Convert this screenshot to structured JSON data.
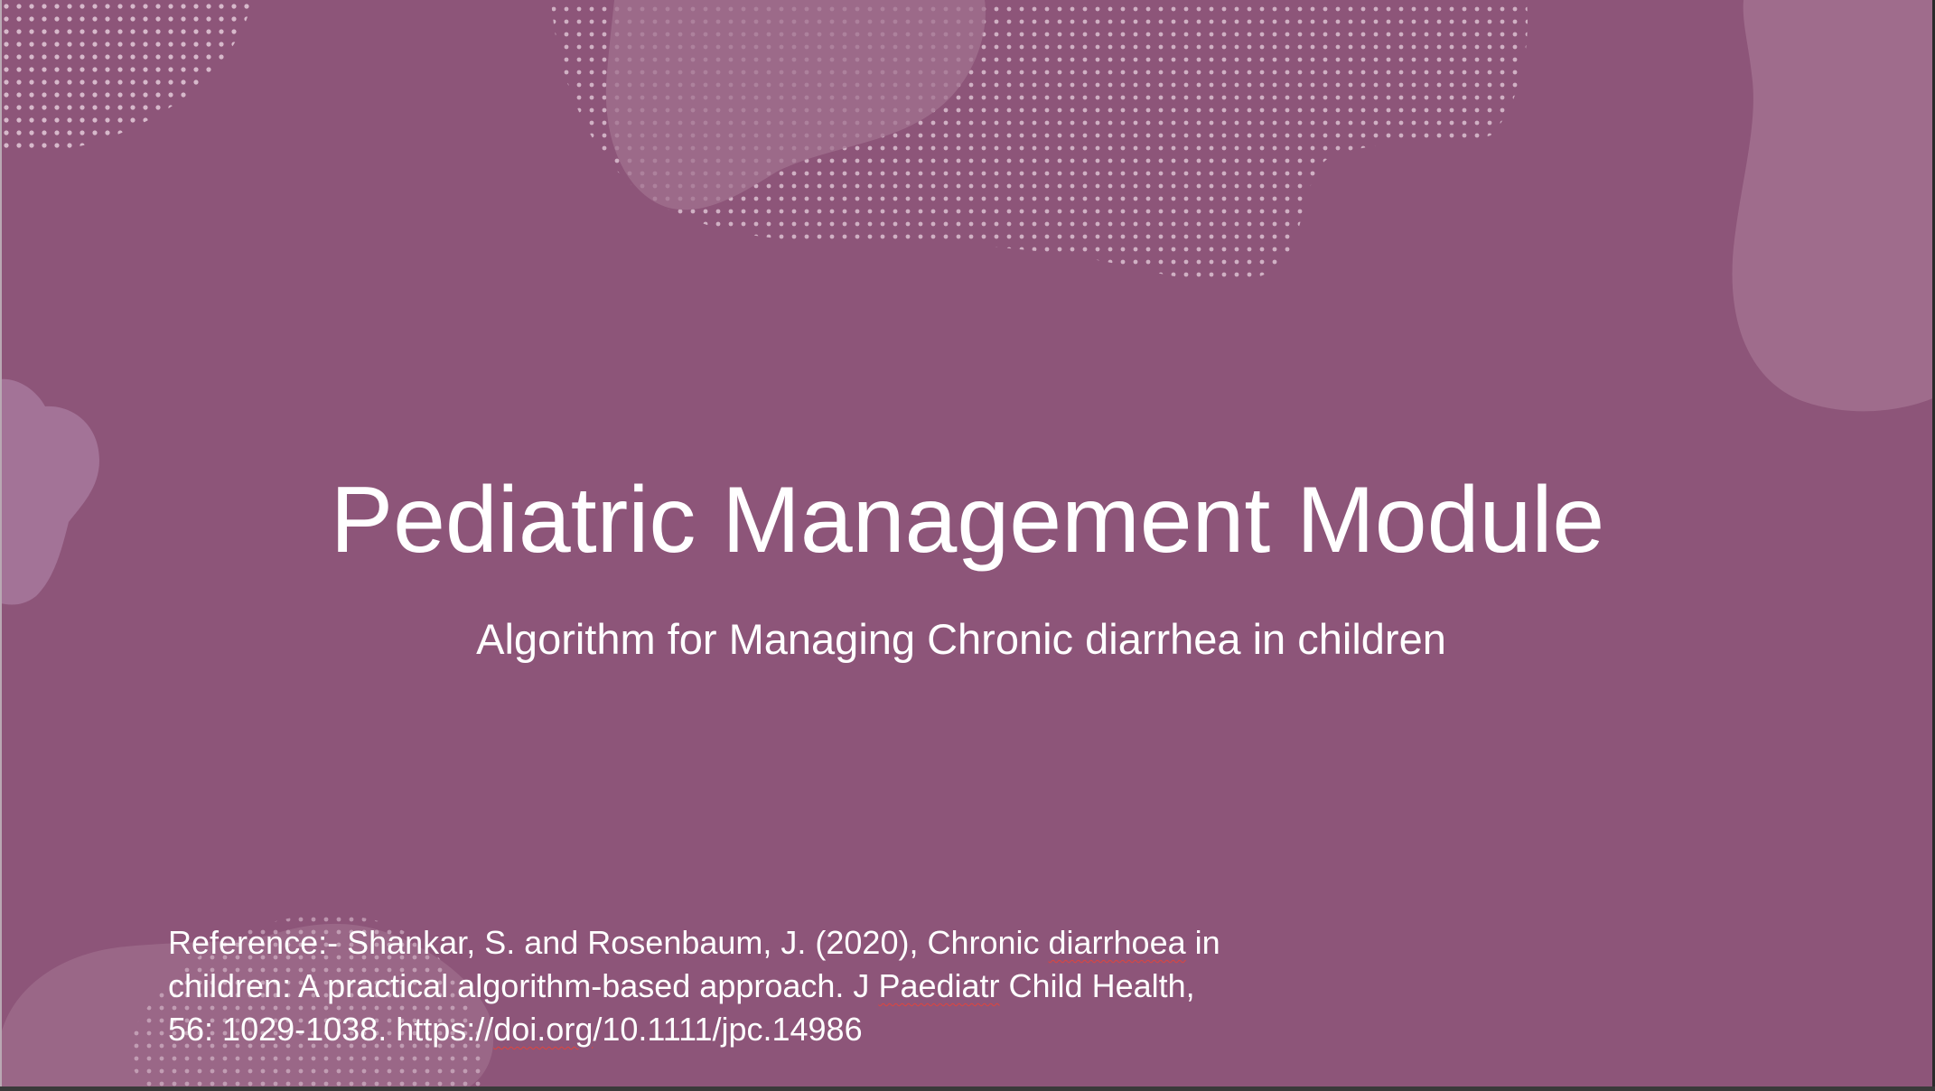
{
  "slide": {
    "title": "Pediatric Management Module",
    "subtitle": "Algorithm for Managing Chronic diarrhea in children",
    "reference": {
      "part1": "Reference:- Shankar, S. and Rosenbaum, J. (2020), Chronic ",
      "word1": "diarrhoea",
      "part2": " in\nchildren: A practical algorithm-based approach. J ",
      "word2": "Paediatr",
      "part3": " Child Health,\n56: 1029-1038. https://",
      "word3": "doi.org",
      "part4": "/10.1111/jpc.14986"
    }
  },
  "colors": {
    "background": "#8d5579",
    "blob": "#a2718f",
    "dots": "#d7b9cb",
    "text": "#ffffff",
    "spellcheck": "#e0443c"
  }
}
